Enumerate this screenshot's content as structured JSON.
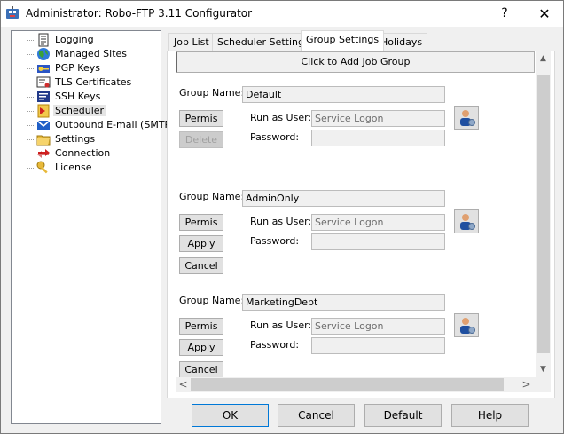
{
  "window": {
    "title": "Administrator: Robo-FTP 3.11 Configurator",
    "help_label": "?",
    "close_label": "✕"
  },
  "tree": {
    "items": [
      {
        "label": "Logging",
        "icon": "logging-icon"
      },
      {
        "label": "Managed Sites",
        "icon": "globe-icon"
      },
      {
        "label": "PGP Keys",
        "icon": "pgp-key-icon"
      },
      {
        "label": "TLS Certificates",
        "icon": "certificate-icon"
      },
      {
        "label": "SSH Keys",
        "icon": "ssh-keys-icon"
      },
      {
        "label": "Scheduler",
        "icon": "scheduler-icon"
      },
      {
        "label": "Outbound E-mail (SMTP)",
        "icon": "envelope-icon"
      },
      {
        "label": "Settings",
        "icon": "folder-icon"
      },
      {
        "label": "Connection",
        "icon": "connection-icon"
      },
      {
        "label": "License",
        "icon": "key-icon"
      }
    ],
    "selected": "Scheduler"
  },
  "tabs": [
    {
      "label": "Job List"
    },
    {
      "label": "Scheduler Settings"
    },
    {
      "label": "Group Settings"
    },
    {
      "label": "Holidays"
    }
  ],
  "active_tab": "Group Settings",
  "add_group_label": "Click to Add Job Group",
  "labels": {
    "group_name": "Group Name:",
    "run_as_user": "Run as User:",
    "password": "Password:"
  },
  "groups": [
    {
      "name": "Default",
      "run_as": "Service Logon",
      "password": "",
      "buttons": [
        "Permis",
        "Delete"
      ]
    },
    {
      "name": "AdminOnly",
      "run_as": "Service Logon",
      "password": "",
      "buttons": [
        "Permis",
        "Apply",
        "Cancel"
      ]
    },
    {
      "name": "MarketingDept",
      "run_as": "Service Logon",
      "password": "",
      "buttons": [
        "Permis",
        "Apply",
        "Cancel"
      ]
    }
  ],
  "scroll": {
    "up": "▲",
    "down": "▼",
    "left": "<",
    "right": ">"
  },
  "dialog_buttons": {
    "ok": "OK",
    "cancel": "Cancel",
    "default": "Default",
    "help": "Help"
  }
}
